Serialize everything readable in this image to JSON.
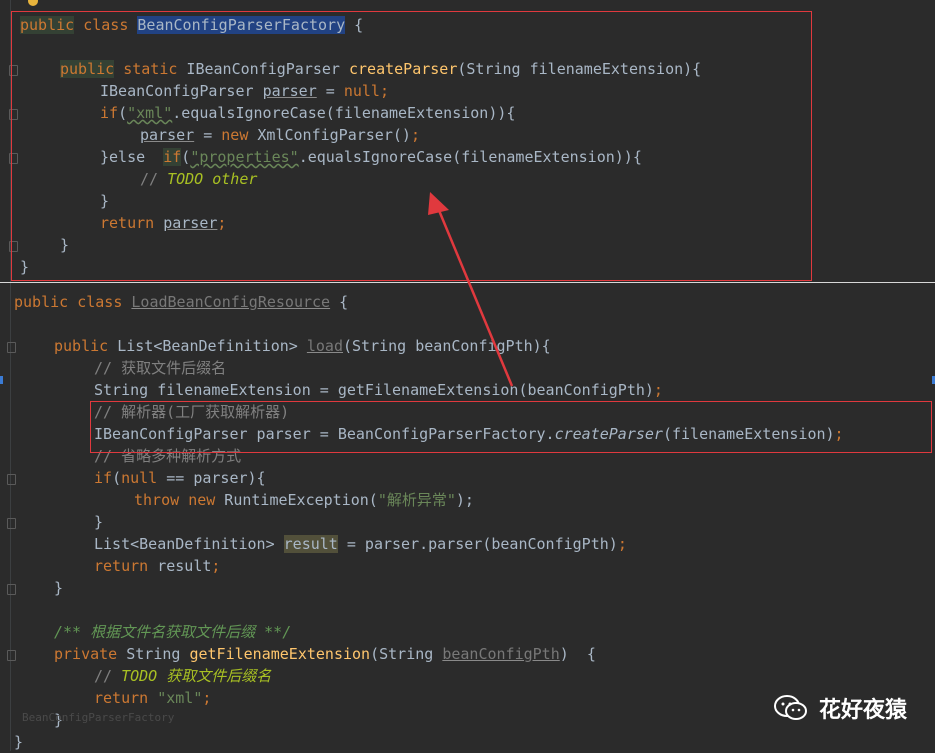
{
  "top_file": {
    "lines": [
      [
        "public",
        " ",
        "class",
        " ",
        "BeanConfigParserFactory",
        " {"
      ],
      [
        "public",
        " ",
        "static",
        " IBeanConfigParser ",
        "createParser",
        "(String filenameExtension){"
      ],
      [
        "IBeanConfigParser ",
        "parser",
        " = ",
        "null",
        ";"
      ],
      [
        "if",
        "(",
        "\"xml\"",
        ".equalsIgnoreCase(filenameExtension)){"
      ],
      [
        "parser",
        " = ",
        "new",
        " XmlConfigParser()",
        ";"
      ],
      [
        "}else  ",
        "if",
        "(",
        "\"properties\"",
        ".equalsIgnoreCase(filenameExtension)){"
      ],
      [
        "// ",
        "TODO other"
      ],
      [
        "}"
      ],
      [
        "return",
        " ",
        "parser",
        ";"
      ],
      [
        "}"
      ],
      [
        "}"
      ]
    ]
  },
  "bottom_file": {
    "lines": [
      [
        "public",
        " ",
        "class",
        " ",
        "LoadBeanConfigResource",
        " {"
      ],
      [
        "public",
        " List<BeanDefinition> ",
        "load",
        "(String beanConfigPth){"
      ],
      [
        "// 获取文件后缀名"
      ],
      [
        "String filenameExtension = getFilenameExtension(beanConfigPth)",
        ";"
      ],
      [
        "// 解析器(工厂获取解析器)"
      ],
      [
        "IBeanConfigParser parser = BeanConfigParserFactory.",
        "createParser",
        "(filenameExtension)",
        ";"
      ],
      [
        "// 省略多种解析方式"
      ],
      [
        "if",
        "(",
        "null",
        " == parser){"
      ],
      [
        "throw",
        " ",
        "new",
        " RuntimeException(",
        "\"解析异常\"",
        ");"
      ],
      [
        "}"
      ],
      [
        "List<BeanDefinition> ",
        "result",
        " = parser.parser(beanConfigPth)",
        ";"
      ],
      [
        "return",
        " result",
        ";"
      ],
      [
        "}"
      ],
      [
        "/** 根据文件名获取文件后缀 **/"
      ],
      [
        "private",
        " String ",
        "getFilenameExtension",
        "(String ",
        "beanConfigPth",
        ")  {"
      ],
      [
        "// ",
        "TODO",
        " 获取文件后缀名"
      ],
      [
        "return",
        " ",
        "\"xml\"",
        ";"
      ],
      [
        "}"
      ],
      [
        "}"
      ]
    ],
    "ghost_label": "BeanConfigParserFactory"
  },
  "watermark": {
    "text": "花好夜猿",
    "icon": "wechat-icon"
  },
  "colors": {
    "annotation": "#e0393e",
    "keyword": "#cc7832",
    "string": "#6a8759",
    "method": "#ffc66d",
    "comment": "#808080",
    "doc_comment": "#629755",
    "todo": "#a8c023"
  }
}
